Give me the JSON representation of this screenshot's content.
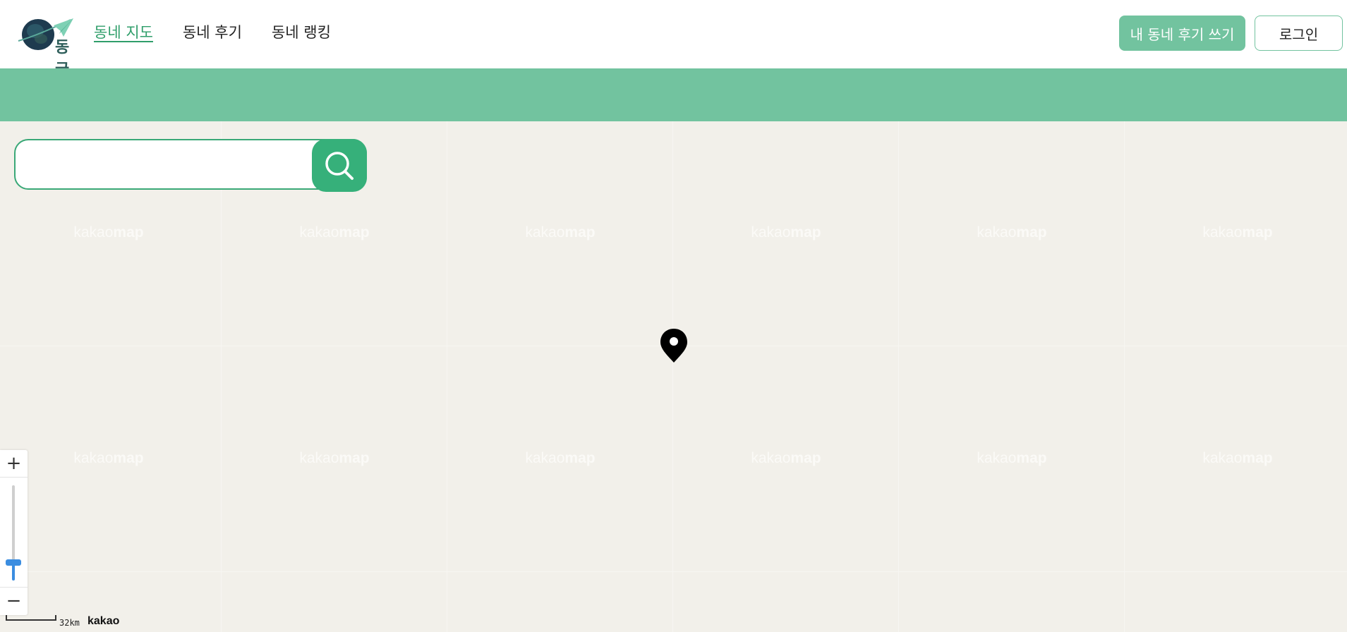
{
  "header": {
    "logo_text": "동글",
    "nav": [
      {
        "label": "동네 지도",
        "active": true
      },
      {
        "label": "동네 후기",
        "active": false
      },
      {
        "label": "동네 랭킹",
        "active": false
      }
    ],
    "write_button_label": "내 동네 후기 쓰기",
    "login_button_label": "로그인"
  },
  "search": {
    "value": "",
    "placeholder": ""
  },
  "map": {
    "watermark_prefix": "kakao",
    "watermark_suffix": "map",
    "zoom_in_label": "+",
    "zoom_out_label": "−",
    "scale_label": "32km",
    "provider_logo": "kakao"
  },
  "colors": {
    "brand_green": "#72c39f",
    "search_green": "#36b07a",
    "map_background": "#f2f0ea"
  }
}
